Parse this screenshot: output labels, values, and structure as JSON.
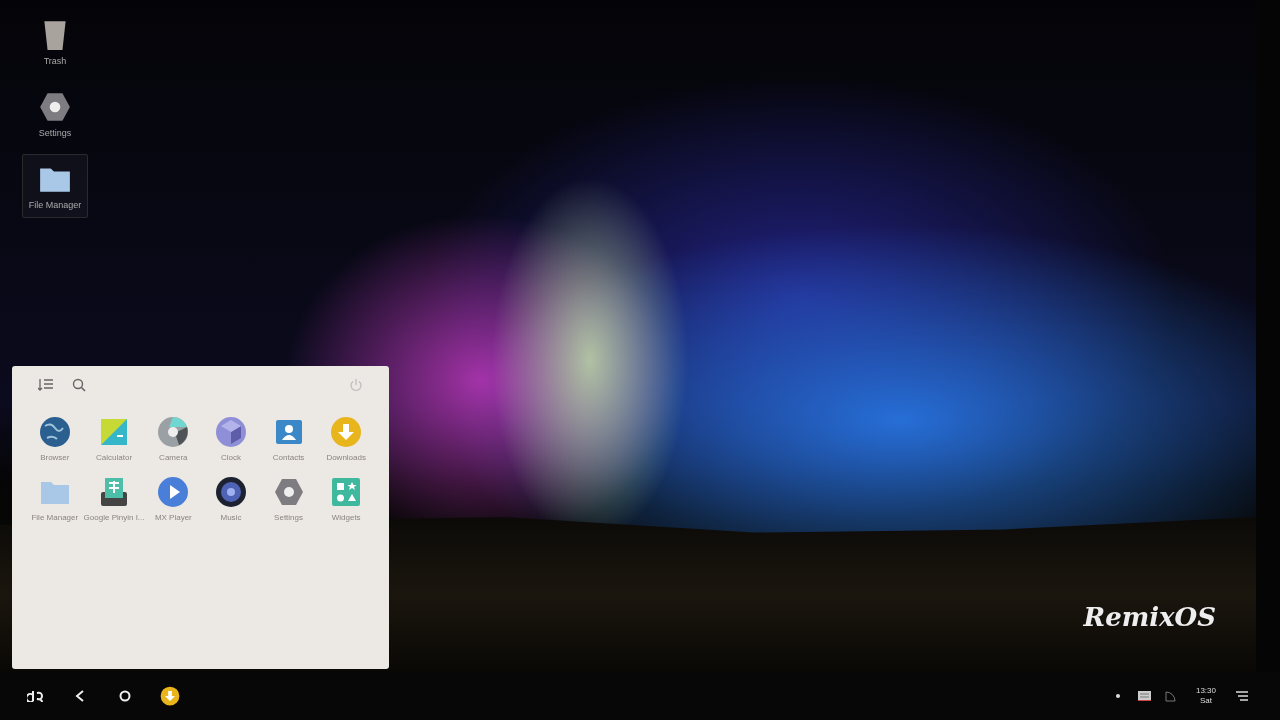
{
  "desktop_icons": [
    {
      "label": "Trash",
      "kind": "trash",
      "selected": false
    },
    {
      "label": "Settings",
      "kind": "settings",
      "selected": false
    },
    {
      "label": "File Manager",
      "kind": "folder",
      "selected": true
    }
  ],
  "start_menu": {
    "apps": [
      {
        "label": "Browser",
        "kind": "globe"
      },
      {
        "label": "Calculator",
        "kind": "calculator"
      },
      {
        "label": "Camera",
        "kind": "camera"
      },
      {
        "label": "Clock",
        "kind": "cube"
      },
      {
        "label": "Contacts",
        "kind": "contacts"
      },
      {
        "label": "Downloads",
        "kind": "download"
      },
      {
        "label": "File Manager",
        "kind": "folder"
      },
      {
        "label": "Google Pinyin I...",
        "kind": "keyboard"
      },
      {
        "label": "MX Player",
        "kind": "play"
      },
      {
        "label": "Music",
        "kind": "speaker"
      },
      {
        "label": "Settings",
        "kind": "settings"
      },
      {
        "label": "Widgets",
        "kind": "widgets"
      }
    ]
  },
  "wallpaper": {
    "logo": "RemixOS"
  },
  "taskbar": {
    "clock_time": "13:30",
    "clock_day": "Sat"
  }
}
